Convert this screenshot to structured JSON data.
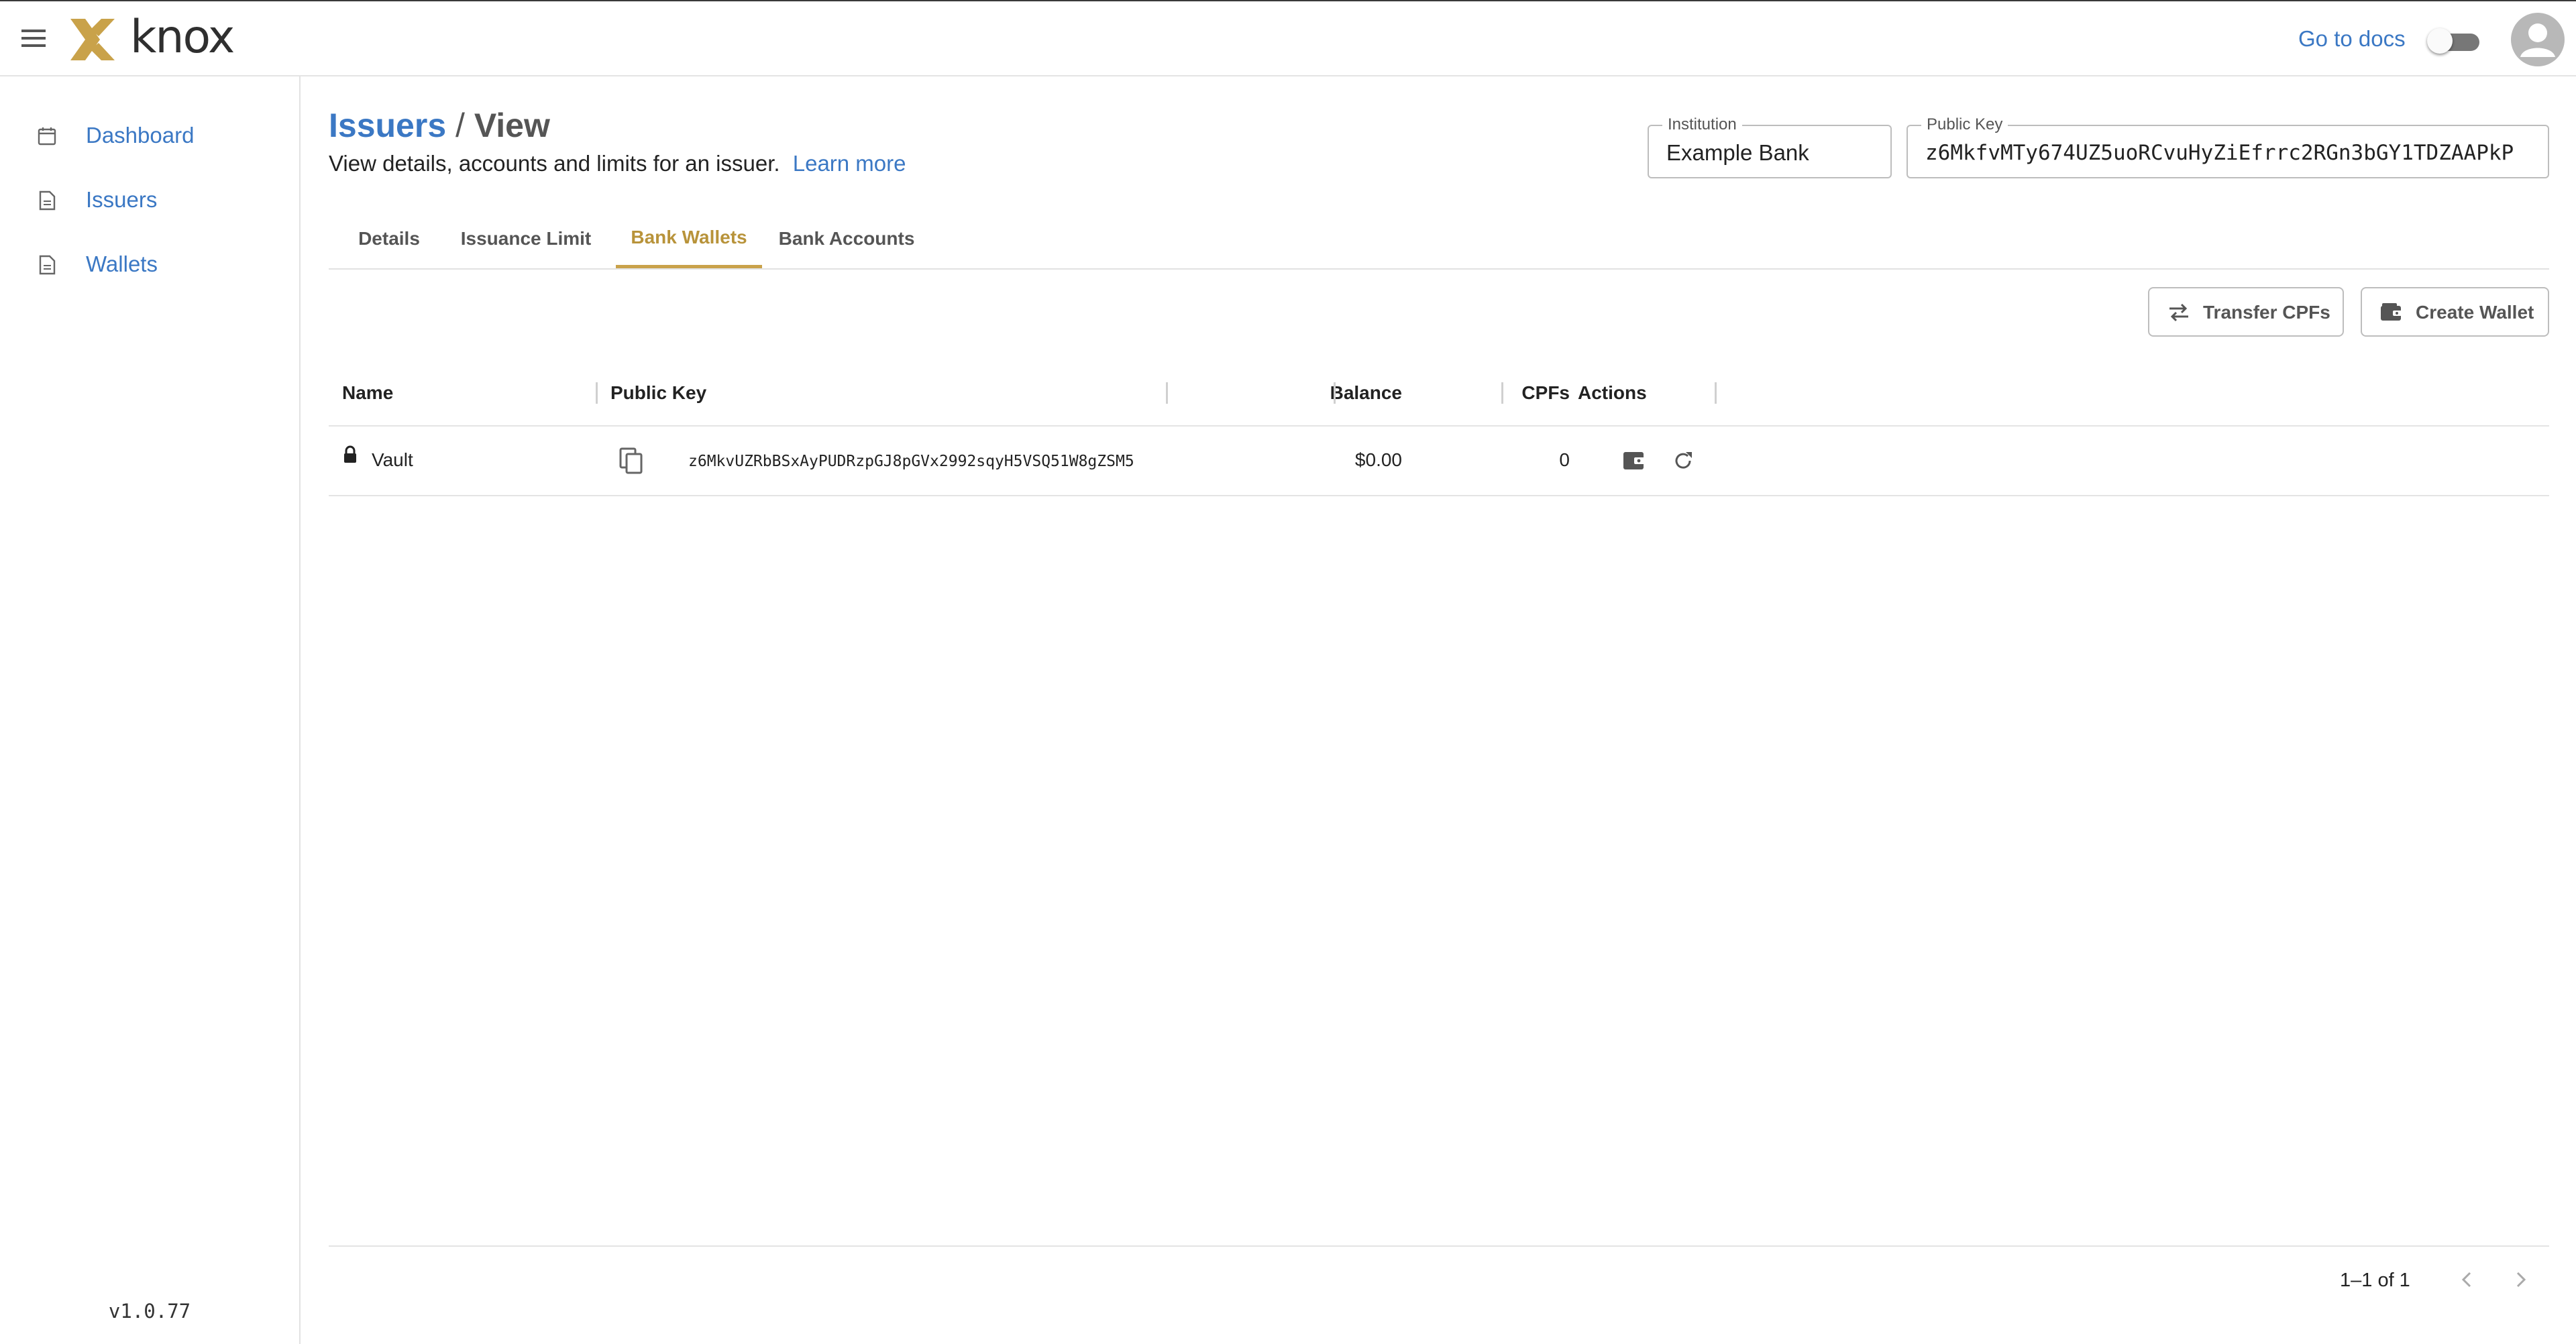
{
  "header": {
    "logo_text": "knox",
    "docs_link": "Go to docs",
    "theme_toggle": "off"
  },
  "sidebar": {
    "items": [
      {
        "label": "Dashboard",
        "icon": "calendar-icon"
      },
      {
        "label": "Issuers",
        "icon": "document-icon"
      },
      {
        "label": "Wallets",
        "icon": "document-icon"
      }
    ],
    "version": "v1.0.77"
  },
  "page": {
    "breadcrumb_parent": "Issuers",
    "breadcrumb_sep": "/",
    "breadcrumb_current": "View",
    "subtitle": "View details, accounts and limits for an issuer.",
    "learn_more": "Learn more"
  },
  "fields": {
    "institution_label": "Institution",
    "institution_value": "Example Bank",
    "public_key_label": "Public Key",
    "public_key_value": "z6MkfvMTy674UZ5uoRCvuHyZiEfrrc2RGn3bGY1TDZAAPkP"
  },
  "tabs": [
    {
      "label": "Details",
      "active": false
    },
    {
      "label": "Issuance Limit",
      "active": false
    },
    {
      "label": "Bank Wallets",
      "active": true
    },
    {
      "label": "Bank Accounts",
      "active": false
    }
  ],
  "actions": {
    "transfer_label": "Transfer CPFs",
    "create_label": "Create Wallet"
  },
  "table": {
    "columns": [
      "Name",
      "Public Key",
      "Balance",
      "CPFs",
      "Actions"
    ],
    "rows": [
      {
        "name": "Vault",
        "public_key": "z6MkvUZRbBSxAyPUDRzpGJ8pGVx2992sqyH5VSQ51W8gZSM5",
        "balance": "$0.00",
        "cpfs": "0"
      }
    ]
  },
  "pagination": {
    "range": "1–1 of 1"
  },
  "colors": {
    "link": "#3b78c4",
    "accent": "#c9a24a"
  }
}
